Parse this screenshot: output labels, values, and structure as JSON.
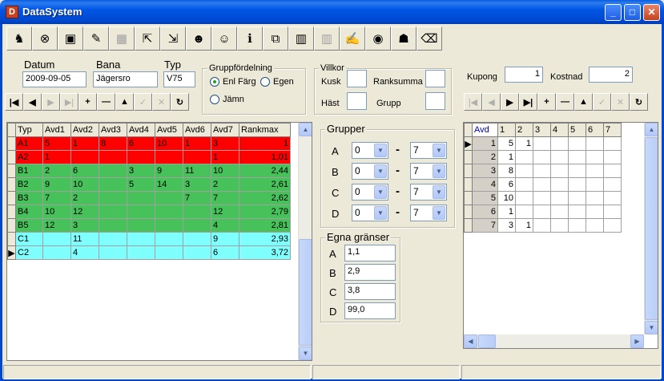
{
  "window": {
    "title": "DataSystem",
    "app_icon_glyph": "D"
  },
  "toolbar": [
    {
      "name": "horse-icon",
      "glyph": "♞",
      "enabled": true
    },
    {
      "name": "binoculars-icon",
      "glyph": "⊗",
      "enabled": true
    },
    {
      "name": "save-icon",
      "glyph": "▣",
      "enabled": true
    },
    {
      "name": "pen-icon",
      "glyph": "✎",
      "enabled": true
    },
    {
      "name": "keyboard-icon",
      "glyph": "▦",
      "enabled": false
    },
    {
      "name": "pointer-icon",
      "glyph": "⇱",
      "enabled": true
    },
    {
      "name": "pointer2-icon",
      "glyph": "⇲",
      "enabled": true
    },
    {
      "name": "user-icon",
      "glyph": "☻",
      "enabled": true
    },
    {
      "name": "user2-icon",
      "glyph": "☺",
      "enabled": true
    },
    {
      "name": "info-icon",
      "glyph": "ℹ",
      "enabled": true
    },
    {
      "name": "copy-icon",
      "glyph": "⧉",
      "enabled": true
    },
    {
      "name": "bar-chart-icon",
      "glyph": "▥",
      "enabled": true
    },
    {
      "name": "bar-chart-disabled-icon",
      "glyph": "▥",
      "enabled": false
    },
    {
      "name": "notes-icon",
      "glyph": "✍",
      "enabled": true
    },
    {
      "name": "disc-icon",
      "glyph": "◉",
      "enabled": true
    },
    {
      "name": "users-icon",
      "glyph": "☗",
      "enabled": true
    },
    {
      "name": "eraser-icon",
      "glyph": "⌫",
      "enabled": true
    }
  ],
  "form": {
    "datum_label": "Datum",
    "datum_value": "2009-09-05",
    "bana_label": "Bana",
    "bana_value": "Jägersro",
    "typ_label": "Typ",
    "typ_value": "V75",
    "gruppfordelning_title": "Gruppfördelning",
    "radio_enl_farg": "Enl Färg",
    "radio_egen": "Egen",
    "radio_jamn": "Jämn",
    "villkor_title": "Villkor",
    "kusk_label": "Kusk",
    "ranksumma_label": "Ranksumma",
    "hast_label": "Häst",
    "grupp_label": "Grupp",
    "kusk_value": "",
    "ranksumma_value": "",
    "hast_value": "",
    "grupp_value": "",
    "kupong_label": "Kupong",
    "kupong_value": "1",
    "kostnad_label": "Kostnad",
    "kostnad_value": "2"
  },
  "nav_left": [
    {
      "glyph": "|◀",
      "enabled": true,
      "name": "first-record-button"
    },
    {
      "glyph": "◀",
      "enabled": true,
      "name": "prior-record-button"
    },
    {
      "glyph": "▶",
      "enabled": false,
      "name": "next-record-button"
    },
    {
      "glyph": "▶|",
      "enabled": false,
      "name": "last-record-button"
    },
    {
      "glyph": "+",
      "enabled": true,
      "name": "insert-record-button"
    },
    {
      "glyph": "—",
      "enabled": true,
      "name": "delete-record-button"
    },
    {
      "glyph": "▲",
      "enabled": true,
      "name": "edit-record-button"
    },
    {
      "glyph": "✓",
      "enabled": false,
      "name": "post-record-button"
    },
    {
      "glyph": "✕",
      "enabled": false,
      "name": "cancel-record-button"
    },
    {
      "glyph": "↻",
      "enabled": true,
      "name": "refresh-records-button"
    }
  ],
  "nav_right": [
    {
      "glyph": "|◀",
      "enabled": false,
      "name": "first-record-button"
    },
    {
      "glyph": "◀",
      "enabled": false,
      "name": "prior-record-button"
    },
    {
      "glyph": "▶",
      "enabled": true,
      "name": "next-record-button"
    },
    {
      "glyph": "▶|",
      "enabled": true,
      "name": "last-record-button"
    },
    {
      "glyph": "+",
      "enabled": true,
      "name": "insert-record-button"
    },
    {
      "glyph": "—",
      "enabled": true,
      "name": "delete-record-button"
    },
    {
      "glyph": "▲",
      "enabled": true,
      "name": "edit-record-button"
    },
    {
      "glyph": "✓",
      "enabled": false,
      "name": "post-record-button"
    },
    {
      "glyph": "✕",
      "enabled": false,
      "name": "cancel-record-button"
    },
    {
      "glyph": "↻",
      "enabled": true,
      "name": "refresh-records-button"
    }
  ],
  "grid_left": {
    "columns": [
      "Typ",
      "Avd1",
      "Avd2",
      "Avd3",
      "Avd4",
      "Avd5",
      "Avd6",
      "Avd7",
      "Rankmax"
    ],
    "rows": [
      {
        "group": "A",
        "cells": [
          "A1",
          "5",
          "1",
          "8",
          "6",
          "10",
          "1",
          "3",
          "1"
        ]
      },
      {
        "group": "A",
        "cells": [
          "A2",
          "1",
          "",
          "",
          "",
          "",
          "",
          "1",
          "1,01"
        ]
      },
      {
        "group": "B",
        "cells": [
          "B1",
          "2",
          "6",
          "",
          "3",
          "9",
          "11",
          "10",
          "2,44"
        ]
      },
      {
        "group": "B",
        "cells": [
          "B2",
          "9",
          "10",
          "",
          "5",
          "14",
          "3",
          "2",
          "2,61"
        ]
      },
      {
        "group": "B",
        "cells": [
          "B3",
          "7",
          "2",
          "",
          "",
          "",
          "7",
          "7",
          "2,62"
        ]
      },
      {
        "group": "B",
        "cells": [
          "B4",
          "10",
          "12",
          "",
          "",
          "",
          "",
          "12",
          "2,79"
        ]
      },
      {
        "group": "B",
        "cells": [
          "B5",
          "12",
          "3",
          "",
          "",
          "",
          "",
          "4",
          "2,81"
        ]
      },
      {
        "group": "C",
        "cells": [
          "C1",
          "",
          "11",
          "",
          "",
          "",
          "",
          "9",
          "2,93"
        ]
      },
      {
        "group": "C",
        "cells": [
          "C2",
          "",
          "4",
          "",
          "",
          "",
          "",
          "6",
          "3,72"
        ]
      }
    ],
    "current_row": 8
  },
  "grupper": {
    "title": "Grupper",
    "rows": [
      {
        "label": "A",
        "from": "0",
        "to": "7"
      },
      {
        "label": "B",
        "from": "0",
        "to": "7"
      },
      {
        "label": "C",
        "from": "0",
        "to": "7"
      },
      {
        "label": "D",
        "from": "0",
        "to": "7"
      }
    ],
    "dash": "-"
  },
  "egna_granser": {
    "title": "Egna gränser",
    "rows": [
      {
        "label": "A",
        "value": "1,1"
      },
      {
        "label": "B",
        "value": "2,9"
      },
      {
        "label": "C",
        "value": "3,8"
      },
      {
        "label": "D",
        "value": "99,0"
      }
    ]
  },
  "grid_right": {
    "columns": [
      "Avd",
      "1",
      "2",
      "3",
      "4",
      "5",
      "6",
      "7"
    ],
    "rows": [
      [
        "1",
        "5",
        "1",
        "",
        "",
        "",
        "",
        ""
      ],
      [
        "2",
        "1",
        "",
        "",
        "",
        "",
        "",
        ""
      ],
      [
        "3",
        "8",
        "",
        "",
        "",
        "",
        "",
        ""
      ],
      [
        "4",
        "6",
        "",
        "",
        "",
        "",
        "",
        ""
      ],
      [
        "5",
        "10",
        "",
        "",
        "",
        "",
        "",
        ""
      ],
      [
        "6",
        "1",
        "",
        "",
        "",
        "",
        "",
        ""
      ],
      [
        "7",
        "3",
        "1",
        "",
        "",
        "",
        "",
        ""
      ]
    ],
    "current_row": 0
  },
  "colors": {
    "group_A": "#ff0000",
    "group_B": "#47c15a",
    "group_C": "#80ffff",
    "titlebar": "#0055e5"
  }
}
